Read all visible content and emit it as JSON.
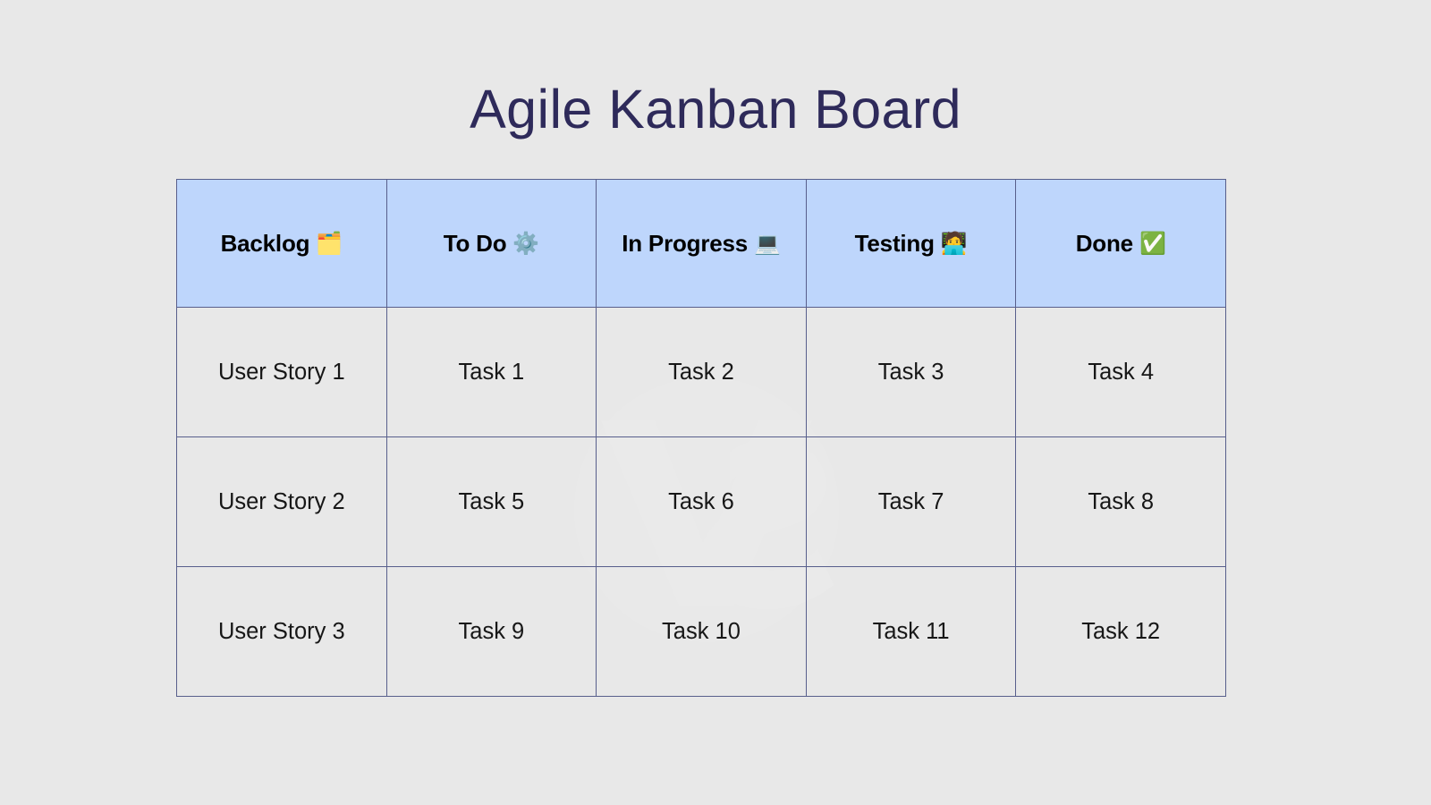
{
  "page": {
    "title": "Agile Kanban Board",
    "background_color": "#e8e8e8",
    "title_color": "#2e2a5a"
  },
  "watermark": {
    "label": "VS",
    "color": "#f2f2f2"
  },
  "board": {
    "header_background": "#bed6fc",
    "border_color": "#585f8c",
    "cell_background": "#e8e8e8",
    "columns": [
      {
        "label": "Backlog",
        "icon": "card-index-dividers-icon",
        "emoji": "🗂️"
      },
      {
        "label": "To Do",
        "icon": "gear-icon",
        "emoji": "⚙️"
      },
      {
        "label": "In Progress",
        "icon": "laptop-icon",
        "emoji": "💻"
      },
      {
        "label": "Testing",
        "icon": "technologist-icon",
        "emoji": "🧑‍💻"
      },
      {
        "label": "Done",
        "icon": "check-mark-button-icon",
        "emoji": "✅"
      }
    ],
    "rows": [
      [
        "User Story 1",
        "Task 1",
        "Task 2",
        "Task 3",
        "Task 4"
      ],
      [
        "User Story 2",
        "Task 5",
        "Task 6",
        "Task 7",
        "Task 8"
      ],
      [
        "User Story 3",
        "Task 9",
        "Task 10",
        "Task 11",
        "Task 12"
      ]
    ]
  }
}
